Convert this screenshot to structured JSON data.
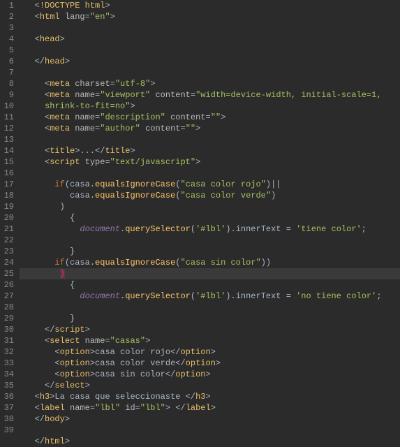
{
  "gutter": {
    "start": 1,
    "end": 39
  },
  "highlight_line": 25,
  "tokens": {
    "doctype": "DOCTYPE html",
    "html": "html",
    "head": "head",
    "meta": "meta",
    "title": "title",
    "script": "script",
    "select": "select",
    "option": "option",
    "h3": "h3",
    "label": "label",
    "body": "body",
    "lang": "lang",
    "en": "\"en\"",
    "charset": "charset",
    "utf8": "\"utf-8\"",
    "name": "name",
    "viewport": "\"viewport\"",
    "content": "content",
    "viewport_val": "\"width=device-width, initial-scale=1,",
    "viewport_val2": "shrink-to-fit=no\"",
    "description": "\"description\"",
    "author": "\"author\"",
    "empty_str": "\"\"",
    "dots": "...",
    "type": "type",
    "textjs": "\"text/javascript\"",
    "casas": "\"casas\"",
    "lbl_str": "\"lbl\"",
    "id": "id",
    "if": "if",
    "casa": "casa",
    "equalsIgnoreCase": "equalsIgnoreCase",
    "casa_rojo": "\"casa color rojo\"",
    "casa_verde": "\"casa color verde\"",
    "casa_sin": "\"casa sin color\"",
    "document": "document",
    "querySelector": "querySelector",
    "lbl_sel": "'#lbl'",
    "innerText": "innerText",
    "tiene": "'tiene color'",
    "no_tiene": "'no tiene color'",
    "opt_rojo": "casa color rojo",
    "opt_verde": "casa color verde",
    "opt_sin": "casa sin color",
    "h3_text": "La casa que seleccionaste "
  },
  "chart_data": null
}
